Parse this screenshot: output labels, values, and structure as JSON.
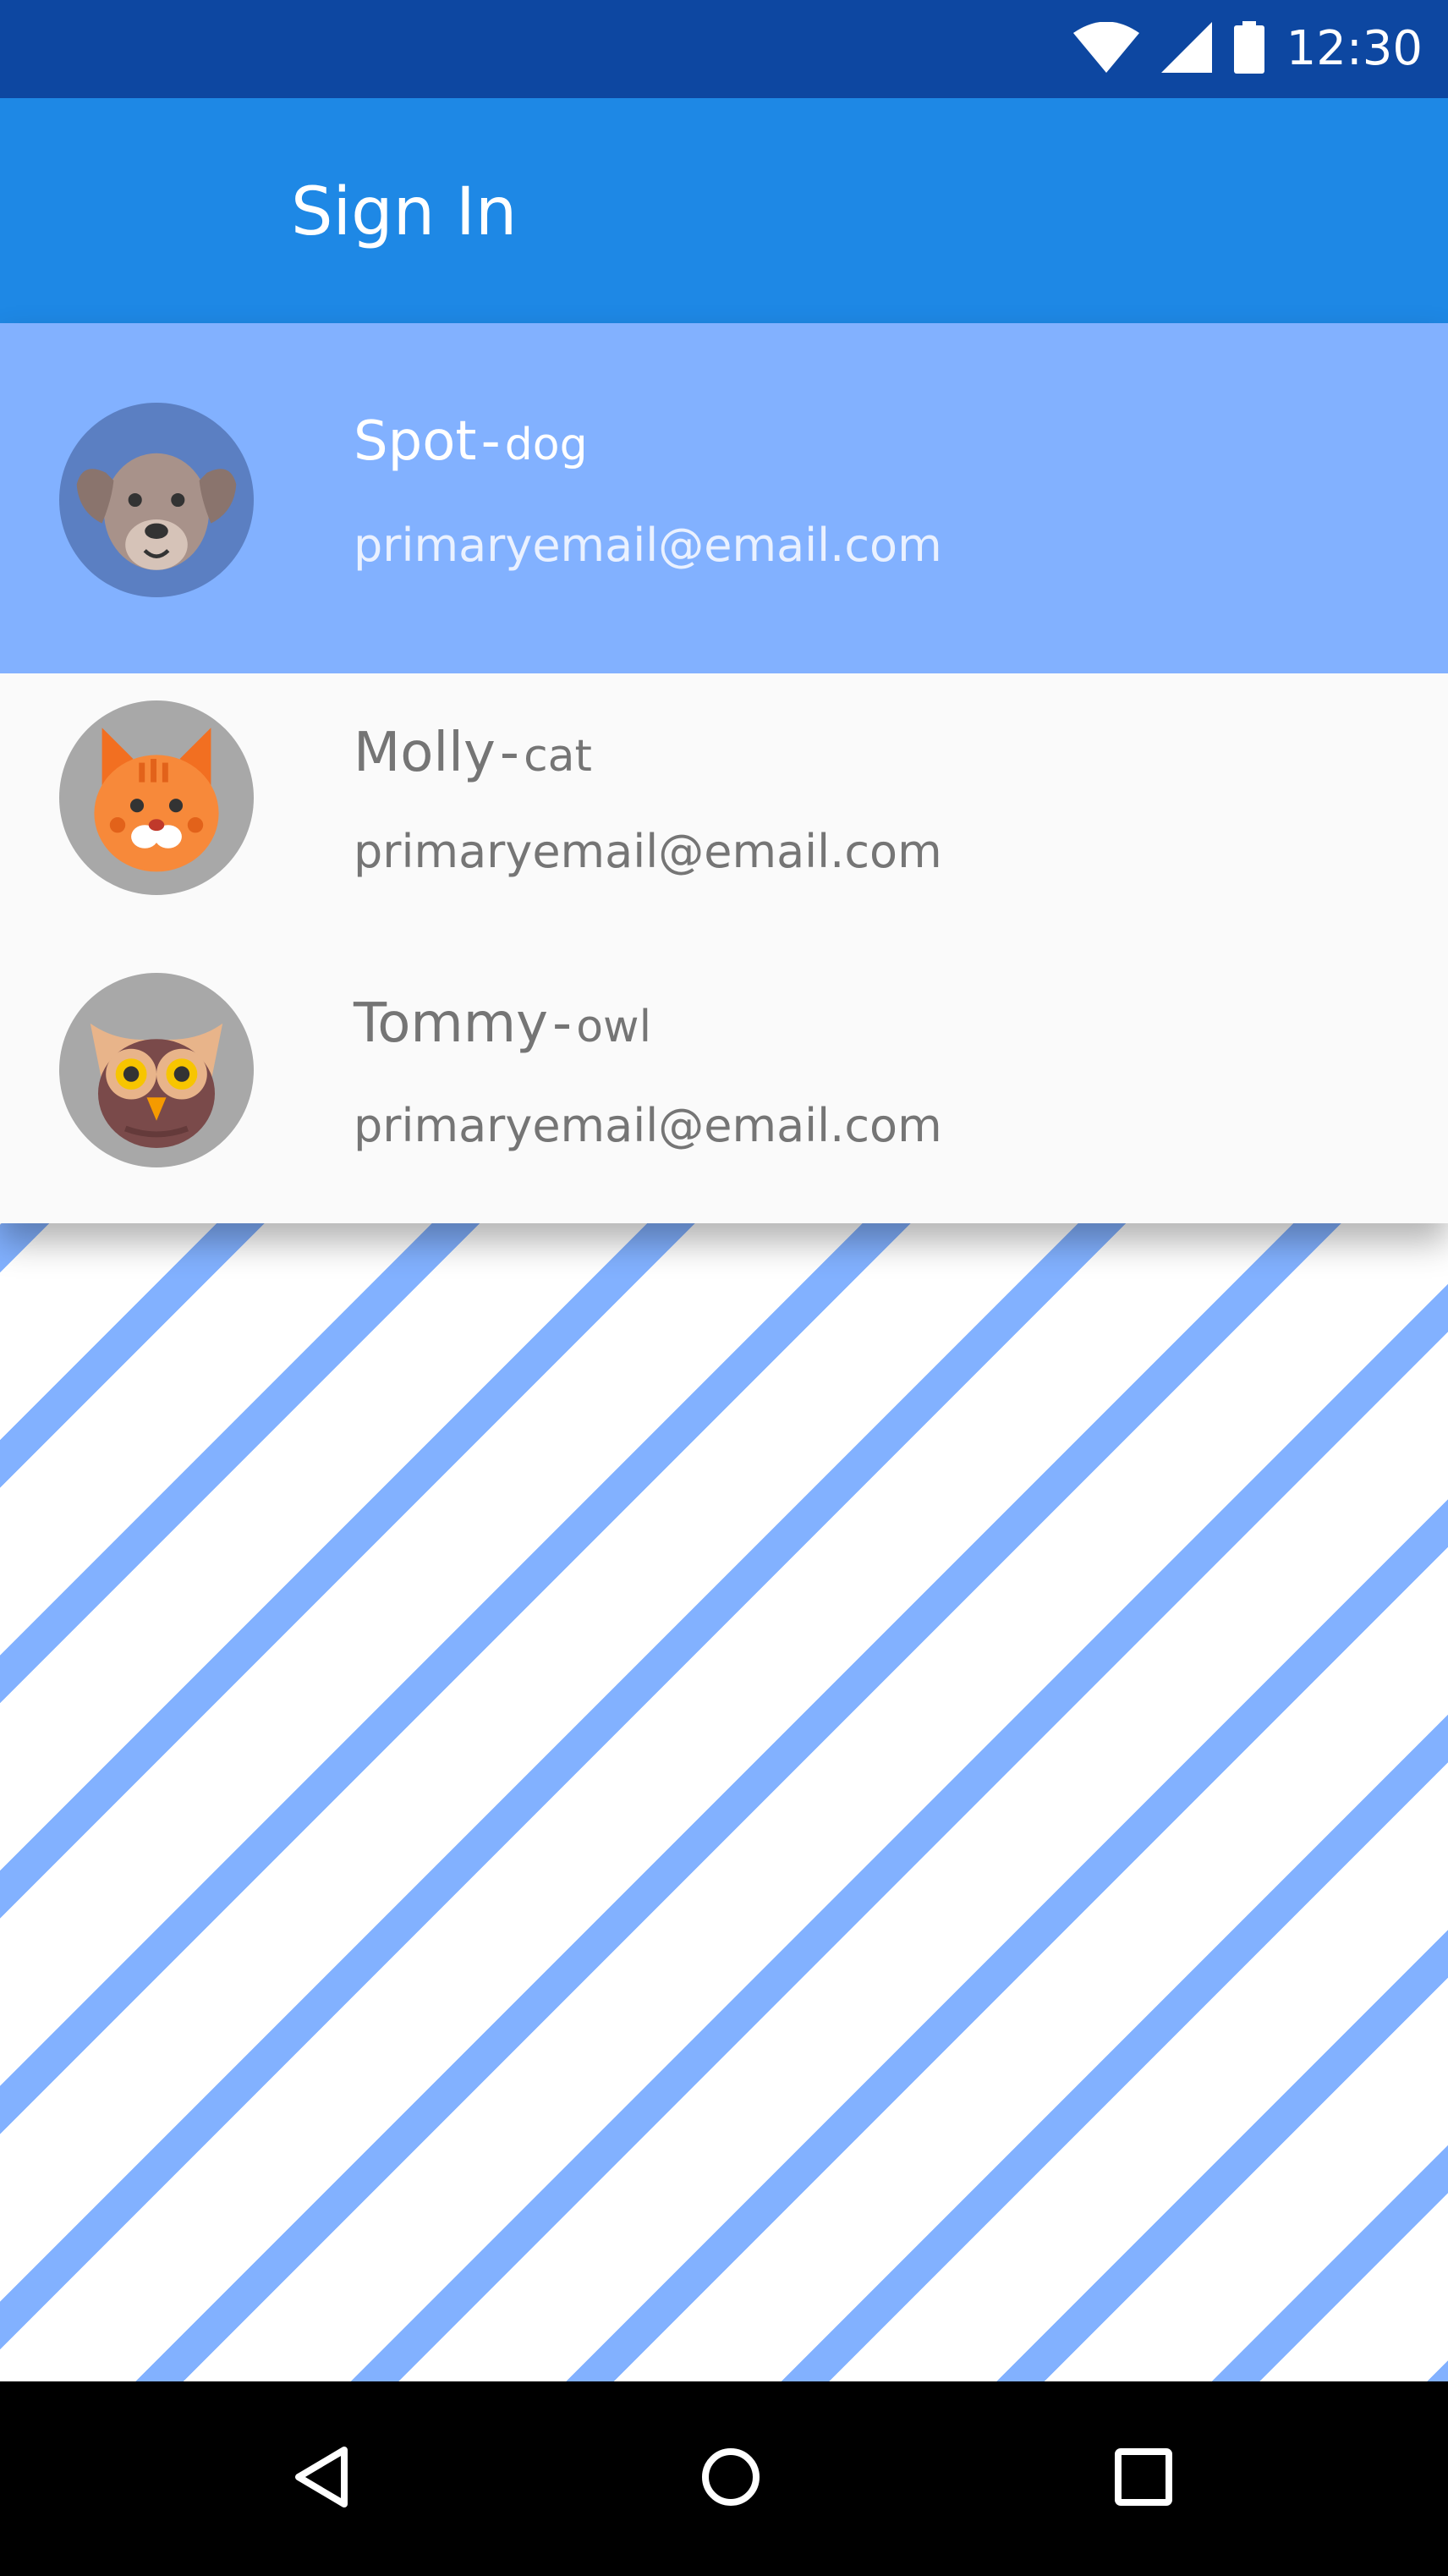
{
  "status_bar": {
    "time": "12:30",
    "icons": [
      "wifi-icon",
      "cell-signal-icon",
      "battery-icon"
    ]
  },
  "app_bar": {
    "title": "Sign In"
  },
  "accounts": [
    {
      "name": "Spot",
      "separator": "-",
      "species": "dog",
      "email": "primaryemail@email.com",
      "avatar_icon": "dog-icon",
      "selected": true
    },
    {
      "name": "Molly",
      "separator": "-",
      "species": "cat",
      "email": "primaryemail@email.com",
      "avatar_icon": "cat-icon",
      "selected": false
    },
    {
      "name": "Tommy",
      "separator": "-",
      "species": "owl",
      "email": "primaryemail@email.com",
      "avatar_icon": "owl-icon",
      "selected": false
    }
  ],
  "nav_bar": {
    "icons": [
      "back-icon",
      "home-icon",
      "recents-icon"
    ]
  },
  "colors": {
    "status_bar": "#0d47a1",
    "app_bar": "#1e88e5",
    "selected_row": "#82b1ff",
    "stripe": "#82b1ff",
    "list_background": "#fafafa",
    "secondary_text": "#757575"
  }
}
